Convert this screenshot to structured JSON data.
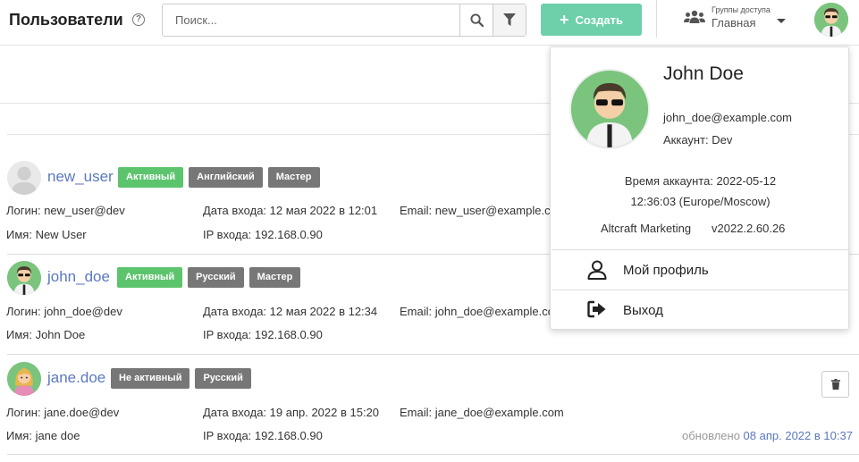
{
  "header": {
    "title": "Пользователи",
    "help_glyph": "?",
    "search_placeholder": "Поиск...",
    "create_label": "Создать",
    "groups_caption": "Группы доступа",
    "groups_value": "Главная"
  },
  "users": [
    {
      "username": "new_user",
      "badges": [
        "Активный",
        "Английский",
        "Мастер"
      ],
      "login_label": "Логин:",
      "login": "new_user@dev",
      "name_label": "Имя:",
      "name": "New User",
      "date_label": "Дата входа:",
      "date": "12 мая 2022 в 12:01",
      "ip_label": "IP входа:",
      "ip": "192.168.0.90",
      "email_label": "Email:",
      "email": "new_user@example.com"
    },
    {
      "username": "john_doe",
      "badges": [
        "Активный",
        "Русский",
        "Мастер"
      ],
      "login_label": "Логин:",
      "login": "john_doe@dev",
      "name_label": "Имя:",
      "name": "John Doe",
      "date_label": "Дата входа:",
      "date": "12 мая 2022 в 12:34",
      "ip_label": "IP входа:",
      "ip": "192.168.0.90",
      "email_label": "Email:",
      "email": "john_doe@example.com"
    },
    {
      "username": "jane.doe",
      "badges": [
        "Не активный",
        "Русский"
      ],
      "login_label": "Логин:",
      "login": "jane.doe@dev",
      "name_label": "Имя:",
      "name": "jane doe",
      "date_label": "Дата входа:",
      "date": "19 апр. 2022 в 15:20",
      "ip_label": "IP входа:",
      "ip": "192.168.0.90",
      "email_label": "Email:",
      "email": "jane_doe@example.com",
      "updated_label": "обновлено",
      "updated": "08 апр. 2022 в 10:37"
    }
  ],
  "popup": {
    "name": "John Doe",
    "email": "john_doe@example.com",
    "account": "Аккаунт: Dev",
    "time_line1": "Время аккаунта: 2022-05-12",
    "time_line2": "12:36:03 (Europe/Moscow)",
    "company": "Altcraft Marketing",
    "version": "v2022.2.60.26",
    "profile_label": "Мой профиль",
    "logout_label": "Выход"
  },
  "colors": {
    "accent_create": "#6dd0ab",
    "badge_active": "#5cc46d",
    "badge_neutral": "#777777",
    "link": "#5b78c0"
  },
  "icons": [
    "help-icon",
    "search-icon",
    "filter-icon",
    "plus-icon",
    "users-group-icon",
    "caret-down-icon",
    "user-icon",
    "logout-icon",
    "trash-icon"
  ]
}
